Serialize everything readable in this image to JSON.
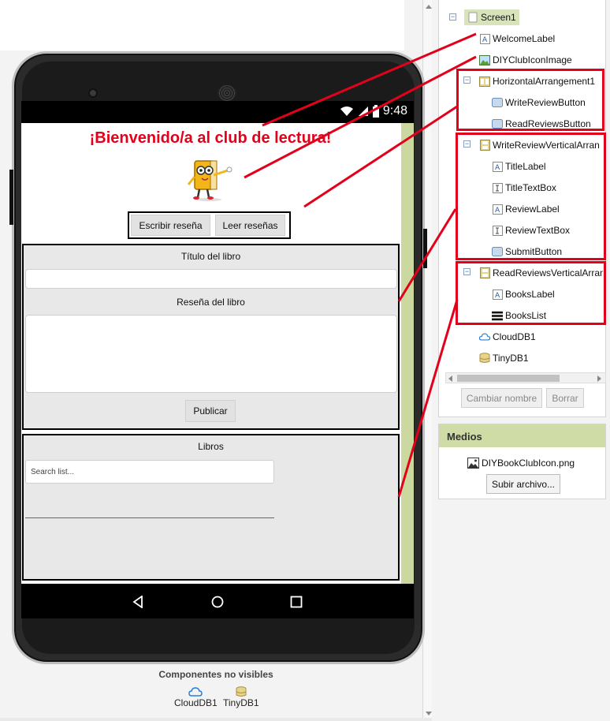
{
  "phone": {
    "time": "9:48",
    "welcome": "¡Bienvenido/a al club de lectura!",
    "buttons": {
      "write": "Escribir reseña",
      "read": "Leer reseñas"
    },
    "write_form": {
      "title_label": "Título del libro",
      "review_label": "Reseña del libro",
      "submit": "Publicar"
    },
    "read_form": {
      "books_label": "Libros",
      "search_placeholder": "Search list..."
    },
    "nav": [
      "back-icon",
      "home-icon",
      "recents-icon"
    ]
  },
  "tree": {
    "screen": "Screen1",
    "items": [
      {
        "label": "WelcomeLabel",
        "icon": "label-icon"
      },
      {
        "label": "DIYClubIconImage",
        "icon": "image-icon"
      },
      {
        "label": "HorizontalArrangement1",
        "icon": "horizontal-arrangement-icon"
      },
      {
        "label": "WriteReviewButton",
        "icon": "button-icon"
      },
      {
        "label": "ReadReviewsButton",
        "icon": "button-icon"
      },
      {
        "label": "WriteReviewVerticalArran",
        "icon": "vertical-arrangement-icon"
      },
      {
        "label": "TitleLabel",
        "icon": "label-icon"
      },
      {
        "label": "TitleTextBox",
        "icon": "textbox-icon"
      },
      {
        "label": "ReviewLabel",
        "icon": "label-icon"
      },
      {
        "label": "ReviewTextBox",
        "icon": "textbox-icon"
      },
      {
        "label": "SubmitButton",
        "icon": "button-icon"
      },
      {
        "label": "ReadReviewsVerticalArran",
        "icon": "vertical-arrangement-icon"
      },
      {
        "label": "BooksLabel",
        "icon": "label-icon"
      },
      {
        "label": "BooksList",
        "icon": "listview-icon"
      },
      {
        "label": "CloudDB1",
        "icon": "cloud-icon"
      },
      {
        "label": "TinyDB1",
        "icon": "database-icon"
      }
    ],
    "rename_button": "Cambiar nombre",
    "delete_button": "Borrar"
  },
  "media": {
    "header": "Medios",
    "file": "DIYBookClubIcon.png",
    "upload_button": "Subir archivo..."
  },
  "nonvisible": {
    "title": "Componentes no visibles",
    "items": [
      {
        "label": "CloudDB1",
        "icon": "cloud-icon"
      },
      {
        "label": "TinyDB1",
        "icon": "database-icon"
      }
    ]
  },
  "colors": {
    "accent_red": "#e3001b",
    "panel_green": "#cfdca6",
    "strip_green": "#cbd9a0"
  }
}
